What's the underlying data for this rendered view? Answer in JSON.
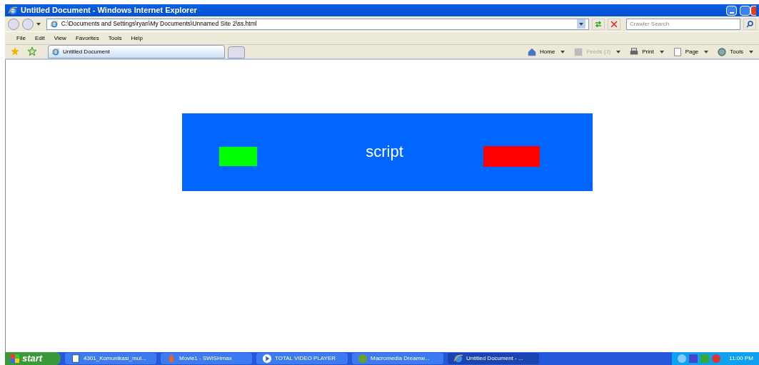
{
  "window": {
    "title": "Untitled Document - Windows Internet Explorer"
  },
  "address": {
    "value": "C:\\Documents and Settings\\ryan\\My Documents\\Unnamed Site 2\\ss.html"
  },
  "search": {
    "placeholder": "Crawler Search"
  },
  "menu": [
    "File",
    "Edit",
    "View",
    "Favorites",
    "Tools",
    "Help"
  ],
  "tabs": [
    {
      "label": "Untitled Document",
      "selected": true
    }
  ],
  "command_bar": [
    {
      "label": "Home",
      "kind": "home",
      "disabled": false
    },
    {
      "label": "Feeds (J)",
      "kind": "feeds",
      "disabled": true
    },
    {
      "label": "Print",
      "kind": "print",
      "disabled": false
    },
    {
      "label": "Page",
      "kind": "page",
      "disabled": false
    },
    {
      "label": "Tools",
      "kind": "tools",
      "disabled": false
    }
  ],
  "page": {
    "banner_text": "script"
  },
  "taskbar": {
    "start": "start",
    "clock": "11:00 PM",
    "items": [
      {
        "label": "4301_Komunikasi_mul...",
        "kind": "doc",
        "selected": false
      },
      {
        "label": "Movie1 - SWiSHmax",
        "kind": "swish",
        "selected": false
      },
      {
        "label": "TOTAL VIDEO PLAYER",
        "kind": "video",
        "selected": false
      },
      {
        "label": "Macromedia Dreamw...",
        "kind": "dw",
        "selected": false
      },
      {
        "label": "Untitled Document - ...",
        "kind": "ie",
        "selected": true
      }
    ]
  }
}
